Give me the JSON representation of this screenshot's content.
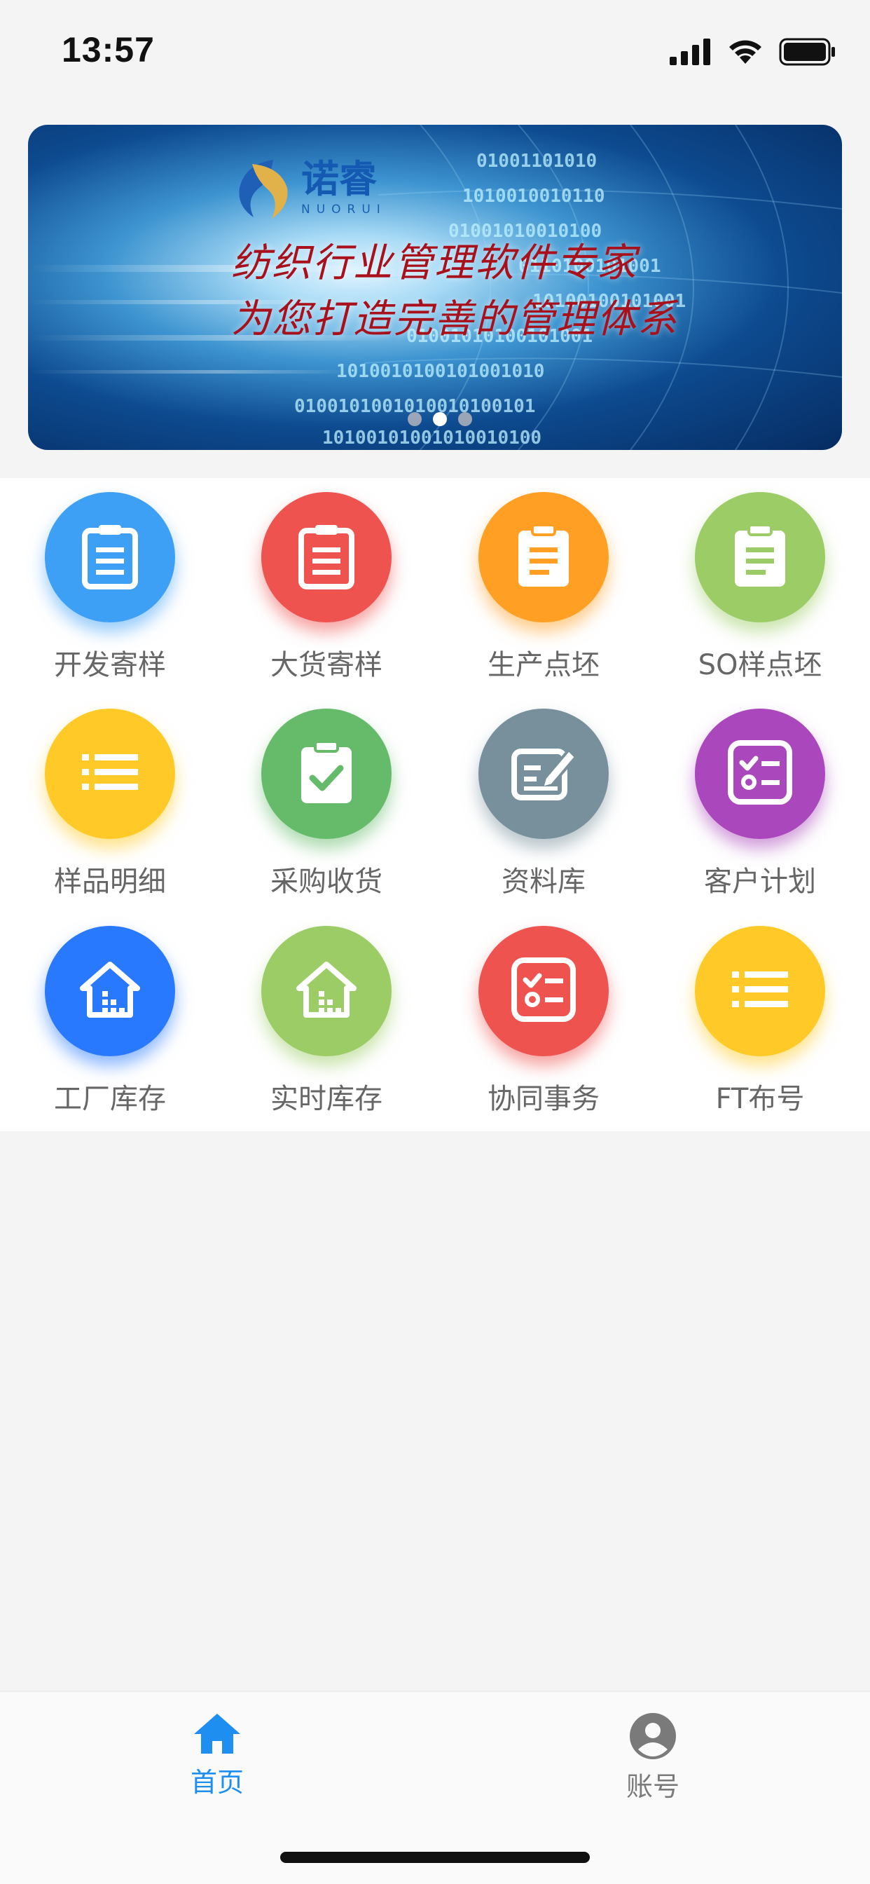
{
  "status_bar": {
    "time": "13:57"
  },
  "banner": {
    "logo_text": "诺睿",
    "logo_sub": "NUORUI",
    "line1": "纺织行业管理软件专家",
    "line2": "为您打造完善的管理体系",
    "dots": 3,
    "active_dot": 1
  },
  "grid": [
    {
      "label": "开发寄样",
      "color": "#3ea0f5",
      "icon": "clipboard-icon"
    },
    {
      "label": "大货寄样",
      "color": "#ef5350",
      "icon": "clipboard-icon"
    },
    {
      "label": "生产点坯",
      "color": "#ffa025",
      "icon": "clipboard-filled-icon"
    },
    {
      "label": "SO样点坯",
      "color": "#9ccc65",
      "icon": "clipboard-filled-icon"
    },
    {
      "label": "样品明细",
      "color": "#ffca28",
      "icon": "list-icon"
    },
    {
      "label": "采购收货",
      "color": "#66bb6a",
      "icon": "clipboard-check-icon"
    },
    {
      "label": "资料库",
      "color": "#78909c",
      "icon": "edit-icon"
    },
    {
      "label": "客户计划",
      "color": "#ab47bc",
      "icon": "checklist-icon"
    },
    {
      "label": "工厂库存",
      "color": "#2979ff",
      "icon": "warehouse-icon"
    },
    {
      "label": "实时库存",
      "color": "#9ccc65",
      "icon": "warehouse-icon"
    },
    {
      "label": "协同事务",
      "color": "#ef5350",
      "icon": "checklist-icon"
    },
    {
      "label": "FT布号",
      "color": "#ffca28",
      "icon": "list-icon"
    }
  ],
  "tabs": [
    {
      "label": "首页",
      "icon": "home-icon",
      "active": true,
      "color": "#1e8ef0"
    },
    {
      "label": "账号",
      "icon": "account-icon",
      "active": false,
      "color": "#7a7a7a"
    }
  ]
}
